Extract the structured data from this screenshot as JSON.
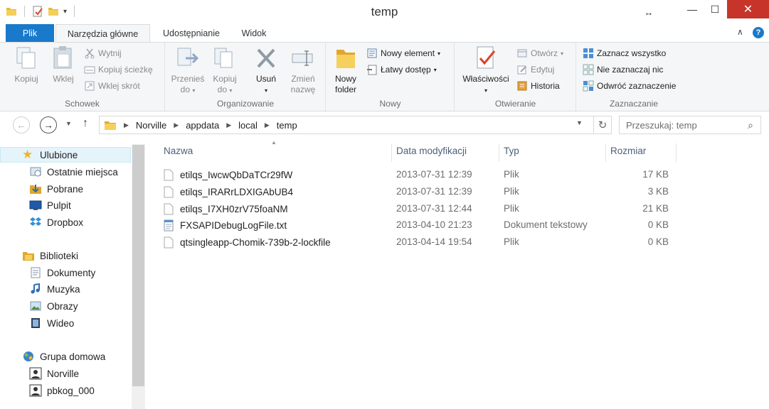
{
  "window": {
    "title": "temp",
    "minimize": "—",
    "maximize": "☐",
    "close": "✕",
    "resize_indicator": "↔"
  },
  "ribbon_tabs": {
    "file": "Plik",
    "home": "Narzędzia główne",
    "share": "Udostępnianie",
    "view": "Widok",
    "collapse": "∧",
    "help": "?"
  },
  "ribbon": {
    "clipboard": {
      "label": "Schowek",
      "copy": "Kopiuj",
      "paste": "Wklej",
      "cut": "Wytnij",
      "copy_path": "Kopiuj ścieżkę",
      "paste_shortcut": "Wklej skrót"
    },
    "organize": {
      "label": "Organizowanie",
      "move_to_1": "Przenieś",
      "move_to_2": "do",
      "copy_to_1": "Kopiuj",
      "copy_to_2": "do",
      "delete": "Usuń",
      "rename_1": "Zmień",
      "rename_2": "nazwę"
    },
    "new": {
      "label": "Nowy",
      "new_folder_1": "Nowy",
      "new_folder_2": "folder",
      "new_item": "Nowy element",
      "easy_access": "Łatwy dostęp"
    },
    "open": {
      "label": "Otwieranie",
      "properties": "Właściwości",
      "open": "Otwórz",
      "edit": "Edytuj",
      "history": "Historia"
    },
    "select": {
      "label": "Zaznaczanie",
      "select_all": "Zaznacz wszystko",
      "select_none": "Nie zaznaczaj nic",
      "invert": "Odwróć zaznaczenie"
    }
  },
  "address": {
    "segments": [
      "Norville",
      "appdata",
      "local",
      "temp"
    ],
    "search_placeholder": "Przeszukaj: temp"
  },
  "nav_pane": {
    "favorites": "Ulubione",
    "recent": "Ostatnie miejsca",
    "downloads": "Pobrane",
    "desktop": "Pulpit",
    "dropbox": "Dropbox",
    "libraries": "Biblioteki",
    "documents": "Dokumenty",
    "music": "Muzyka",
    "pictures": "Obrazy",
    "videos": "Wideo",
    "homegroup": "Grupa domowa",
    "user1": "Norville",
    "user2": "pbkog_000"
  },
  "columns": {
    "name": "Nazwa",
    "date": "Data modyfikacji",
    "type": "Typ",
    "size": "Rozmiar"
  },
  "files": [
    {
      "name": "etilqs_IwcwQbDaTCr29fW",
      "date": "2013-07-31 12:39",
      "type": "Plik",
      "size": "17 KB",
      "icon": "blank-file-icon"
    },
    {
      "name": "etilqs_IRARrLDXIGAbUB4",
      "date": "2013-07-31 12:39",
      "type": "Plik",
      "size": "3 KB",
      "icon": "blank-file-icon"
    },
    {
      "name": "etilqs_I7XH0zrV75foaNM",
      "date": "2013-07-31 12:44",
      "type": "Plik",
      "size": "21 KB",
      "icon": "blank-file-icon"
    },
    {
      "name": "FXSAPIDebugLogFile.txt",
      "date": "2013-04-10 21:23",
      "type": "Dokument tekstowy",
      "size": "0 KB",
      "icon": "text-file-icon"
    },
    {
      "name": "qtsingleapp-Chomik-739b-2-lockfile",
      "date": "2013-04-14 19:54",
      "type": "Plik",
      "size": "0 KB",
      "icon": "blank-file-icon"
    }
  ],
  "colors": {
    "accent": "#1979ca",
    "close": "#c7352a",
    "folder": "#e8b935"
  }
}
